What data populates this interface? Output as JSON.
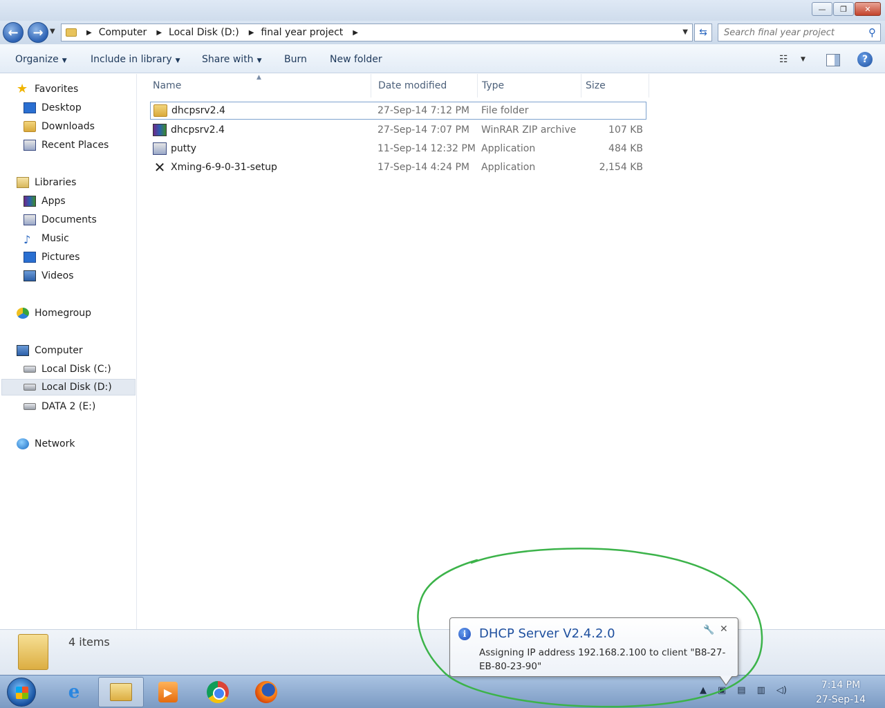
{
  "window": {
    "minimize": "—",
    "maximize": "❐",
    "close": "✕"
  },
  "address": {
    "crumbs": [
      "Computer",
      "Local Disk (D:)",
      "final year project"
    ],
    "search_placeholder": "Search final year project"
  },
  "toolbar": {
    "organize": "Organize",
    "include_in_library": "Include in library",
    "share_with": "Share with",
    "burn": "Burn",
    "new_folder": "New folder"
  },
  "nav": {
    "favorites": "Favorites",
    "desktop": "Desktop",
    "downloads": "Downloads",
    "recent_places": "Recent Places",
    "libraries": "Libraries",
    "apps": "Apps",
    "documents": "Documents",
    "music": "Music",
    "pictures": "Pictures",
    "videos": "Videos",
    "homegroup": "Homegroup",
    "computer": "Computer",
    "local_disk_c": "Local Disk (C:)",
    "local_disk_d": "Local Disk (D:)",
    "data2_e": "DATA 2 (E:)",
    "network": "Network"
  },
  "columns": {
    "name": "Name",
    "date": "Date modified",
    "type": "Type",
    "size": "Size"
  },
  "files": [
    {
      "name": "dhcpsrv2.4",
      "date": "27-Sep-14 7:12 PM",
      "type": "File folder",
      "size": ""
    },
    {
      "name": "dhcpsrv2.4",
      "date": "27-Sep-14 7:07 PM",
      "type": "WinRAR ZIP archive",
      "size": "107 KB"
    },
    {
      "name": "putty",
      "date": "11-Sep-14 12:32 PM",
      "type": "Application",
      "size": "484 KB"
    },
    {
      "name": "Xming-6-9-0-31-setup",
      "date": "17-Sep-14 4:24 PM",
      "type": "Application",
      "size": "2,154 KB"
    }
  ],
  "details": {
    "item_count": "4 items"
  },
  "notification": {
    "title": "DHCP Server V2.4.2.0",
    "message": "Assigning IP address 192.168.2.100 to client \"B8-27-EB-80-23-90\""
  },
  "clock": {
    "time": "7:14 PM",
    "date": "27-Sep-14"
  },
  "colors": {
    "accent": "#1e4f9e",
    "annotation": "#3cb34a"
  }
}
